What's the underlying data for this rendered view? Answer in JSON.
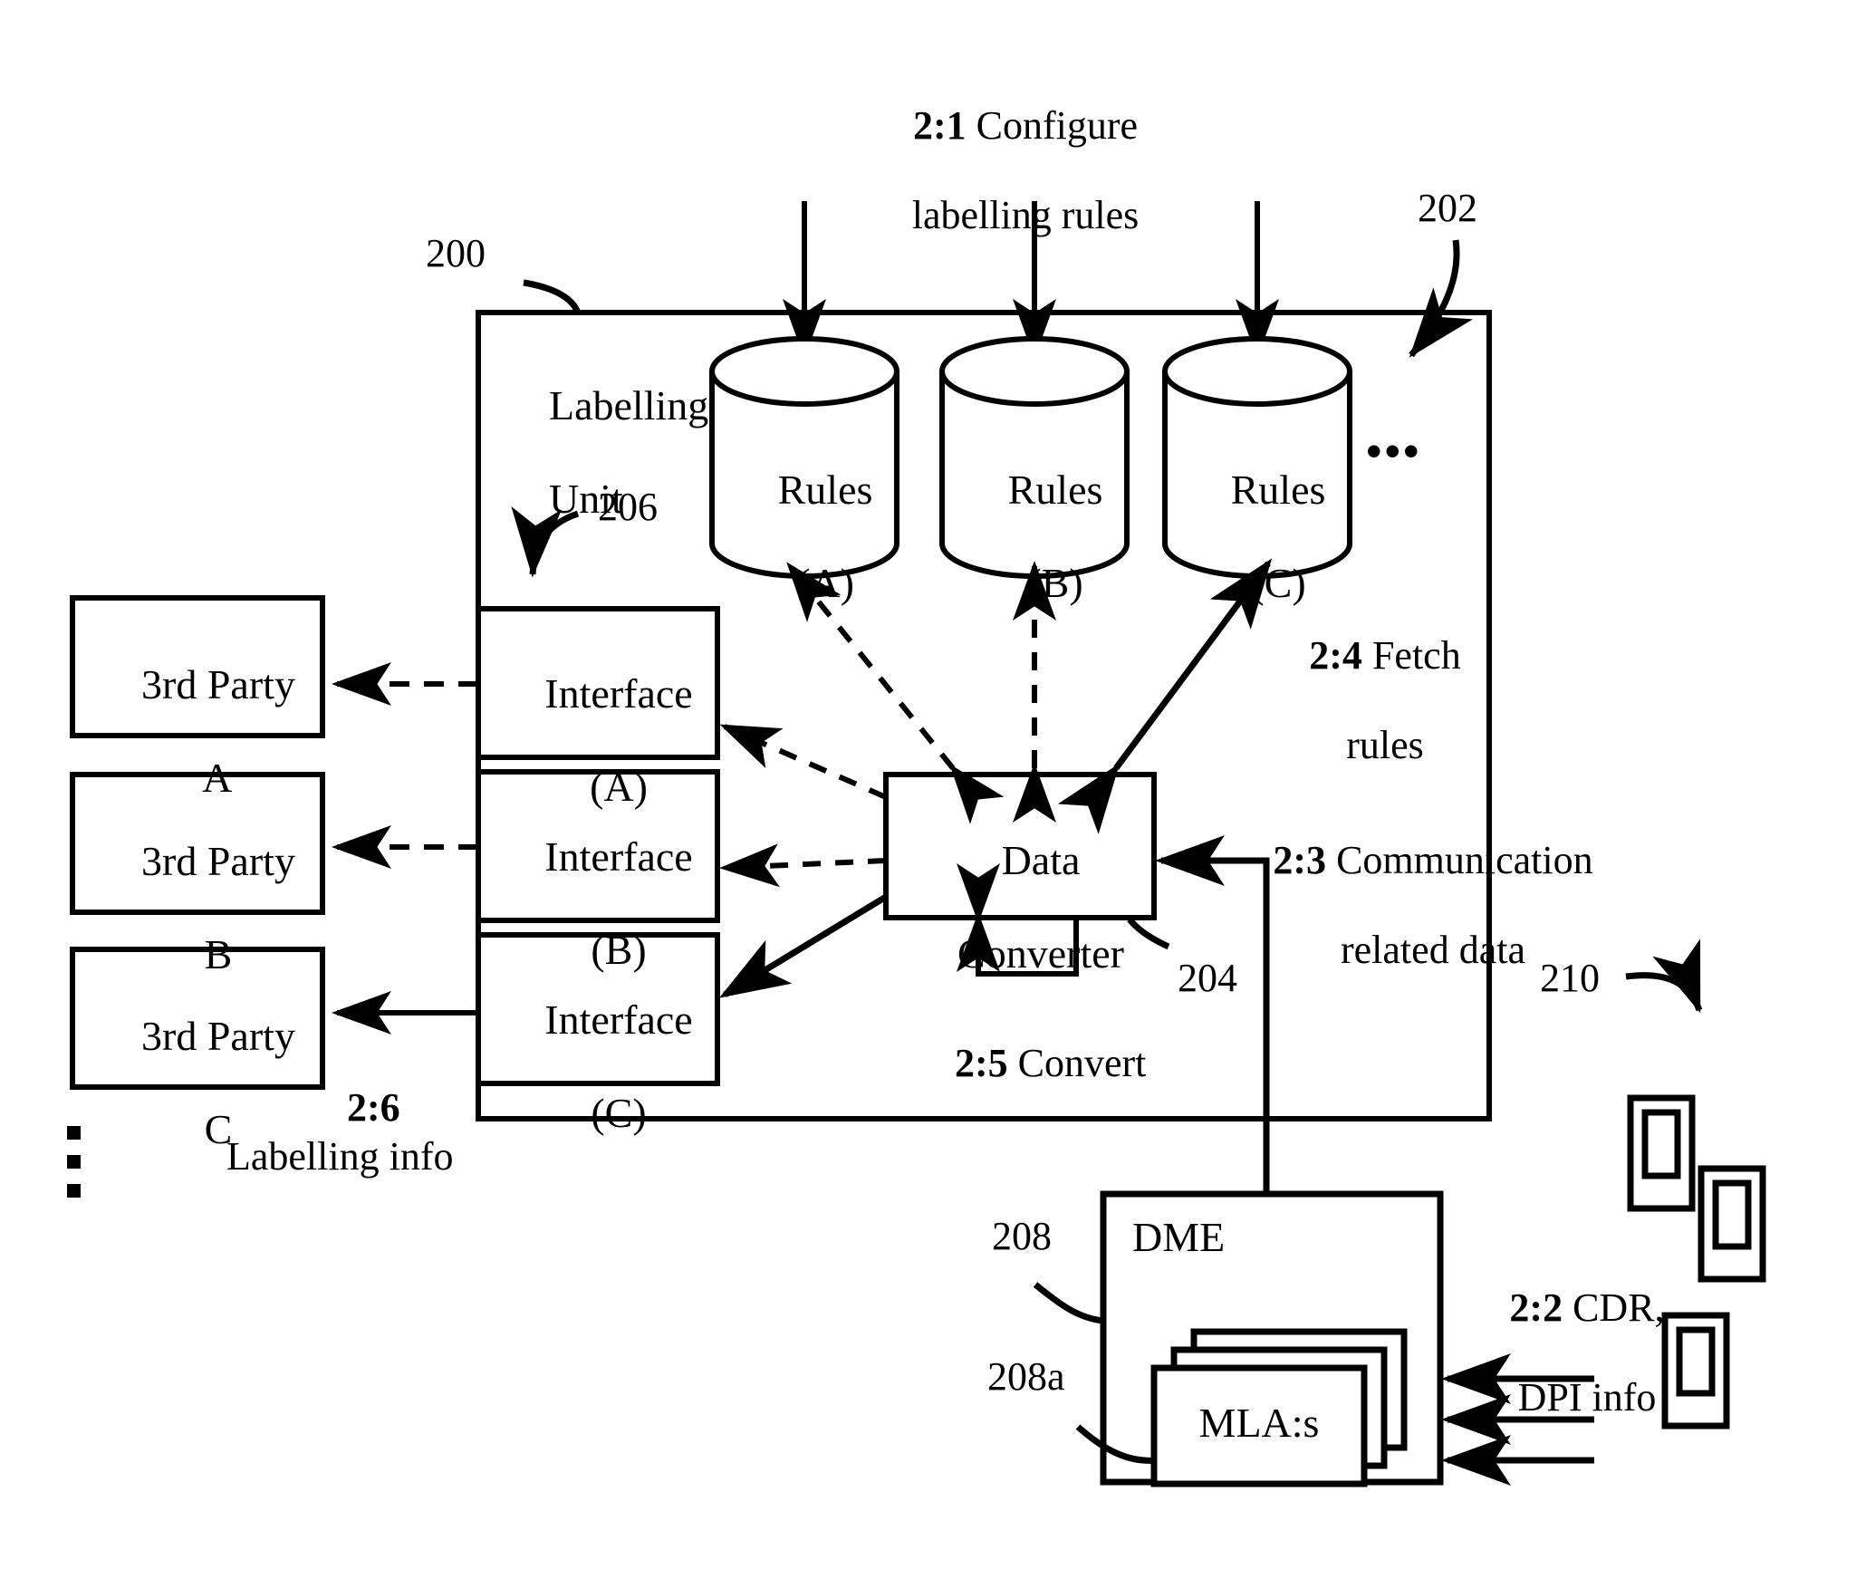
{
  "figure": {
    "type": "patent-block-diagram",
    "background": "#ffffff",
    "stroke": "#000000"
  },
  "reference_numerals": {
    "labelling_unit": "200",
    "rules_storage": "202",
    "data_converter": "204",
    "interfaces": "206",
    "dme": "208",
    "mlas": "208a",
    "devices": "210"
  },
  "blocks": {
    "labelling_unit": {
      "title_line1": "Labelling",
      "title_line2": "Unit"
    },
    "rules": [
      {
        "line1": "Rules",
        "line2": "(A)"
      },
      {
        "line1": "Rules",
        "line2": "(B)"
      },
      {
        "line1": "Rules",
        "line2": "(C)"
      }
    ],
    "rules_ellipsis": "•••",
    "interfaces": [
      {
        "line1": "Interface",
        "line2": "(A)"
      },
      {
        "line1": "Interface",
        "line2": "(B)"
      },
      {
        "line1": "Interface",
        "line2": "(C)"
      }
    ],
    "third_parties": [
      {
        "line1": "3rd Party",
        "line2": "A"
      },
      {
        "line1": "3rd Party",
        "line2": "B"
      },
      {
        "line1": "3rd Party",
        "line2": "C"
      }
    ],
    "third_party_ellipsis": "⋮",
    "data_converter": {
      "line1": "Data",
      "line2": "Converter"
    },
    "dme": {
      "label": "DME"
    },
    "mlas": {
      "label": "MLA:s"
    }
  },
  "steps": {
    "s1": {
      "num": "2:1",
      "text_line1": "Configure",
      "text_line2": "labelling rules"
    },
    "s2": {
      "num": "2:2",
      "text_line1": "CDR,",
      "text_line2": "DPI info"
    },
    "s3": {
      "num": "2:3",
      "text_line1": "Communication",
      "text_line2": "related data"
    },
    "s4": {
      "num": "2:4",
      "text_line1": "Fetch",
      "text_line2": "rules"
    },
    "s5": {
      "num": "2:5",
      "text_line1": "Convert"
    },
    "s6": {
      "num": "2:6",
      "text_line1": "Labelling info"
    }
  },
  "devices": {
    "icon_name": "mobile-device-icon",
    "count": 3
  }
}
